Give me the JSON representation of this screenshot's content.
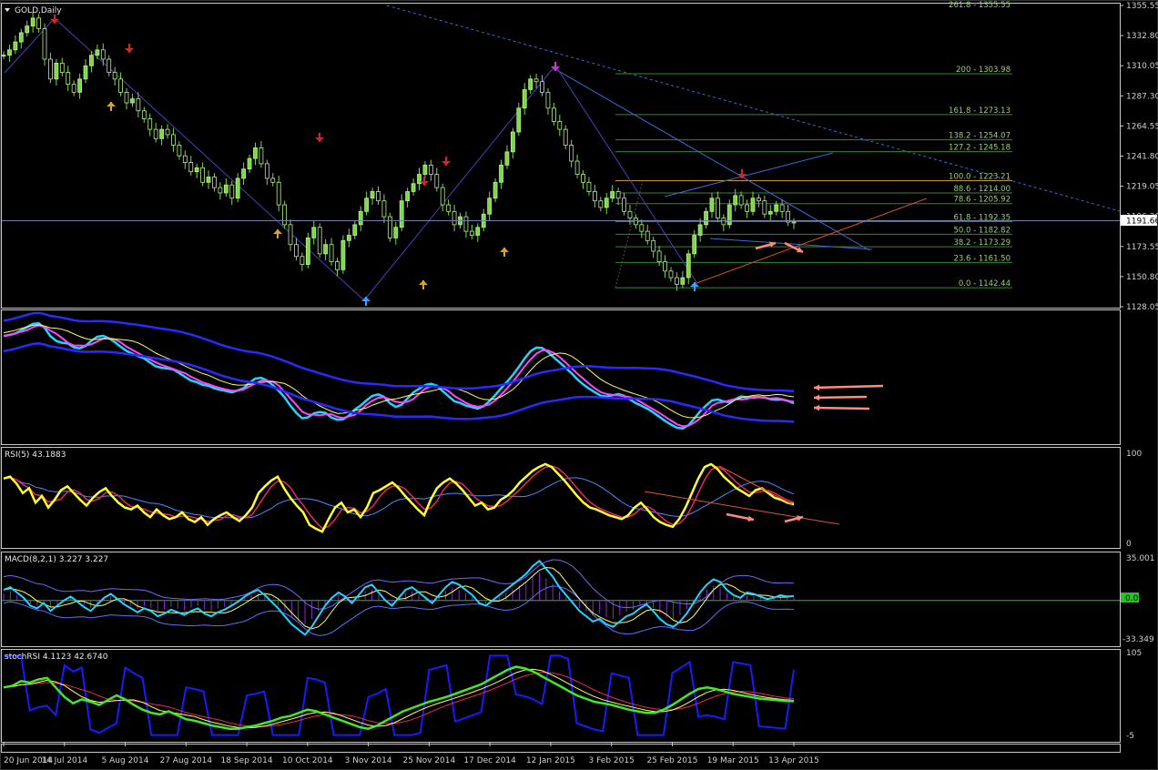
{
  "chart_data": {
    "type": "line",
    "symbol": "GOLD",
    "title": "GOLD,Daily",
    "colors": {
      "background": "#000000",
      "frame": "#c0c0c0",
      "candle_up": "#7cd84a",
      "candle_down": "#b9ef8c",
      "fib": "#2f8a2f",
      "trend_blue": "#3b6ad8",
      "trend_orange": "#e0552a",
      "arrow_up": "#d8a52a",
      "arrow_down": "#e02020",
      "arrow_pink": "#ff8a80",
      "price_line": "#6c84a8"
    },
    "x_tick_labels": [
      "20 Jun 2014",
      "14 Jul 2014",
      "5 Aug 2014",
      "27 Aug 2014",
      "18 Sep 2014",
      "10 Oct 2014",
      "3 Nov 2014",
      "25 Nov 2014",
      "17 Dec 2014",
      "12 Jan 2015",
      "3 Feb 2015",
      "25 Feb 2015",
      "19 Mar 2015",
      "13 Apr 2015"
    ],
    "price_panel": {
      "y_tick_labels": [
        "1355.55",
        "1332.80",
        "1310.05",
        "1287.30",
        "1264.55",
        "1241.80",
        "1219.05",
        "1196.30",
        "1173.55",
        "1150.80",
        "1128.05"
      ],
      "ylim": [
        1128.05,
        1355.55
      ],
      "current_price": "1191.66",
      "close_series": [
        1318,
        1322,
        1328,
        1335,
        1340,
        1346,
        1338,
        1315,
        1300,
        1312,
        1305,
        1296,
        1290,
        1300,
        1310,
        1318,
        1322,
        1315,
        1305,
        1300,
        1290,
        1282,
        1285,
        1276,
        1270,
        1262,
        1255,
        1262,
        1258,
        1250,
        1242,
        1237,
        1230,
        1233,
        1222,
        1226,
        1218,
        1214,
        1220,
        1210,
        1225,
        1232,
        1240,
        1248,
        1236,
        1225,
        1222,
        1205,
        1190,
        1175,
        1166,
        1160,
        1180,
        1188,
        1168,
        1175,
        1162,
        1156,
        1178,
        1182,
        1190,
        1200,
        1210,
        1215,
        1208,
        1196,
        1180,
        1188,
        1208,
        1215,
        1221,
        1228,
        1235,
        1228,
        1218,
        1205,
        1200,
        1190,
        1196,
        1185,
        1182,
        1188,
        1198,
        1210,
        1222,
        1235,
        1245,
        1260,
        1278,
        1292,
        1300,
        1298,
        1290,
        1278,
        1268,
        1262,
        1250,
        1238,
        1228,
        1222,
        1215,
        1208,
        1203,
        1210,
        1215,
        1210,
        1200,
        1195,
        1190,
        1185,
        1178,
        1170,
        1162,
        1155,
        1150,
        1145,
        1150,
        1168,
        1182,
        1190,
        1200,
        1210,
        1195,
        1190,
        1205,
        1212,
        1205,
        1200,
        1210,
        1208,
        1198,
        1200,
        1205,
        1200,
        1192,
        1191.66
      ],
      "fibonacci": [
        {
          "level": "200",
          "price": "1303.98",
          "value": 1303.98
        },
        {
          "level": "161.8",
          "price": "1273.13",
          "value": 1273.13
        },
        {
          "level": "138.2",
          "price": "1254.07",
          "value": 1254.07
        },
        {
          "level": "127.2",
          "price": "1245.18",
          "value": 1245.18
        },
        {
          "level": "100.0",
          "price": "1223.21",
          "value": 1223.21
        },
        {
          "level": "88.6",
          "price": "1214.00",
          "value": 1214.0
        },
        {
          "level": "78.6",
          "price": "1205.92",
          "value": 1205.92
        },
        {
          "level": "61.8",
          "price": "1192.35",
          "value": 1192.35
        },
        {
          "level": "50.0",
          "price": "1182.82",
          "value": 1182.82
        },
        {
          "level": "38.2",
          "price": "1173.29",
          "value": 1173.29
        },
        {
          "level": "23.6",
          "price": "1161.50",
          "value": 1161.5
        },
        {
          "level": "0.0",
          "price": "1142.44",
          "value": 1142.44
        }
      ],
      "fib_label_separator": " - ",
      "top_fib_label": "261.8 - 1355.55"
    },
    "bands_panel": {
      "series_colors": [
        "#22d4ff",
        "#ff44ff",
        "#ffff66",
        "#2a2aff"
      ]
    },
    "rsi_panel": {
      "label": "RSI(5) 43.1883",
      "ylim": [
        0,
        100
      ],
      "y_tick_labels": [
        "100",
        "0"
      ],
      "values": [
        70,
        72,
        65,
        55,
        60,
        45,
        52,
        40,
        48,
        58,
        62,
        55,
        48,
        42,
        50,
        56,
        60,
        52,
        45,
        40,
        38,
        42,
        35,
        30,
        38,
        32,
        28,
        30,
        35,
        28,
        25,
        30,
        22,
        28,
        32,
        35,
        30,
        26,
        32,
        40,
        55,
        62,
        68,
        72,
        60,
        50,
        42,
        35,
        22,
        18,
        15,
        28,
        40,
        45,
        35,
        38,
        30,
        40,
        55,
        58,
        62,
        66,
        60,
        52,
        45,
        38,
        32,
        48,
        60,
        66,
        70,
        65,
        58,
        50,
        42,
        45,
        38,
        40,
        48,
        52,
        58,
        66,
        72,
        78,
        82,
        85,
        82,
        75,
        68,
        60,
        52,
        45,
        40,
        38,
        35,
        32,
        30,
        28,
        32,
        40,
        45,
        38,
        30,
        25,
        22,
        20,
        28,
        40,
        55,
        70,
        82,
        85,
        80,
        72,
        66,
        60,
        56,
        52,
        58,
        60,
        55,
        50,
        48,
        45,
        43.19
      ]
    },
    "macd_panel": {
      "label": "MACD(8,2,1) 3.227 3.227",
      "ylim": [
        -33.349,
        35.001
      ],
      "y_tick_labels": [
        "35.001",
        "0.00",
        "-33.349"
      ],
      "values": [
        8,
        10,
        6,
        2,
        -4,
        -6,
        -2,
        -8,
        -4,
        0,
        3,
        -1,
        -5,
        -8,
        -3,
        2,
        5,
        1,
        -3,
        -6,
        -9,
        -6,
        -8,
        -12,
        -10,
        -7,
        -9,
        -11,
        -8,
        -6,
        -10,
        -12,
        -9,
        -7,
        -4,
        -1,
        3,
        6,
        8,
        4,
        -1,
        -6,
        -12,
        -18,
        -22,
        -26,
        -20,
        -12,
        -4,
        2,
        6,
        3,
        -2,
        4,
        10,
        12,
        6,
        0,
        -4,
        2,
        8,
        10,
        6,
        2,
        -2,
        4,
        10,
        14,
        12,
        8,
        4,
        -2,
        -4,
        0,
        4,
        8,
        12,
        16,
        20,
        26,
        30,
        24,
        18,
        10,
        4,
        -2,
        -8,
        -12,
        -16,
        -14,
        -18,
        -20,
        -16,
        -12,
        -10,
        -6,
        -3,
        -8,
        -14,
        -18,
        -20,
        -16,
        -10,
        -2,
        6,
        12,
        16,
        14,
        8,
        4,
        2,
        6,
        5,
        3,
        1,
        2,
        4,
        3,
        3.227
      ]
    },
    "stochrsi_panel": {
      "label": "stochRSI 4.1123 42.6740",
      "ylim": [
        -5,
        105
      ],
      "y_tick_labels": [
        "105",
        "-5"
      ],
      "values": [
        60,
        62,
        68,
        66,
        70,
        72,
        60,
        48,
        40,
        45,
        42,
        38,
        44,
        50,
        45,
        38,
        32,
        28,
        26,
        30,
        25,
        20,
        18,
        15,
        12,
        10,
        8,
        8,
        10,
        12,
        15,
        18,
        22,
        24,
        28,
        32,
        30,
        26,
        22,
        18,
        14,
        10,
        8,
        12,
        18,
        24,
        30,
        34,
        38,
        42,
        45,
        48,
        52,
        56,
        60,
        64,
        70,
        76,
        82,
        86,
        84,
        80,
        74,
        68,
        62,
        56,
        50,
        46,
        42,
        40,
        38,
        35,
        32,
        30,
        28,
        28,
        32,
        38,
        45,
        52,
        58,
        60,
        58,
        55,
        52,
        50,
        48,
        46,
        45,
        44,
        43,
        42.67
      ]
    },
    "annotations": [
      "fibonacci retracement",
      "triangle trendlines",
      "signal arrows"
    ]
  }
}
